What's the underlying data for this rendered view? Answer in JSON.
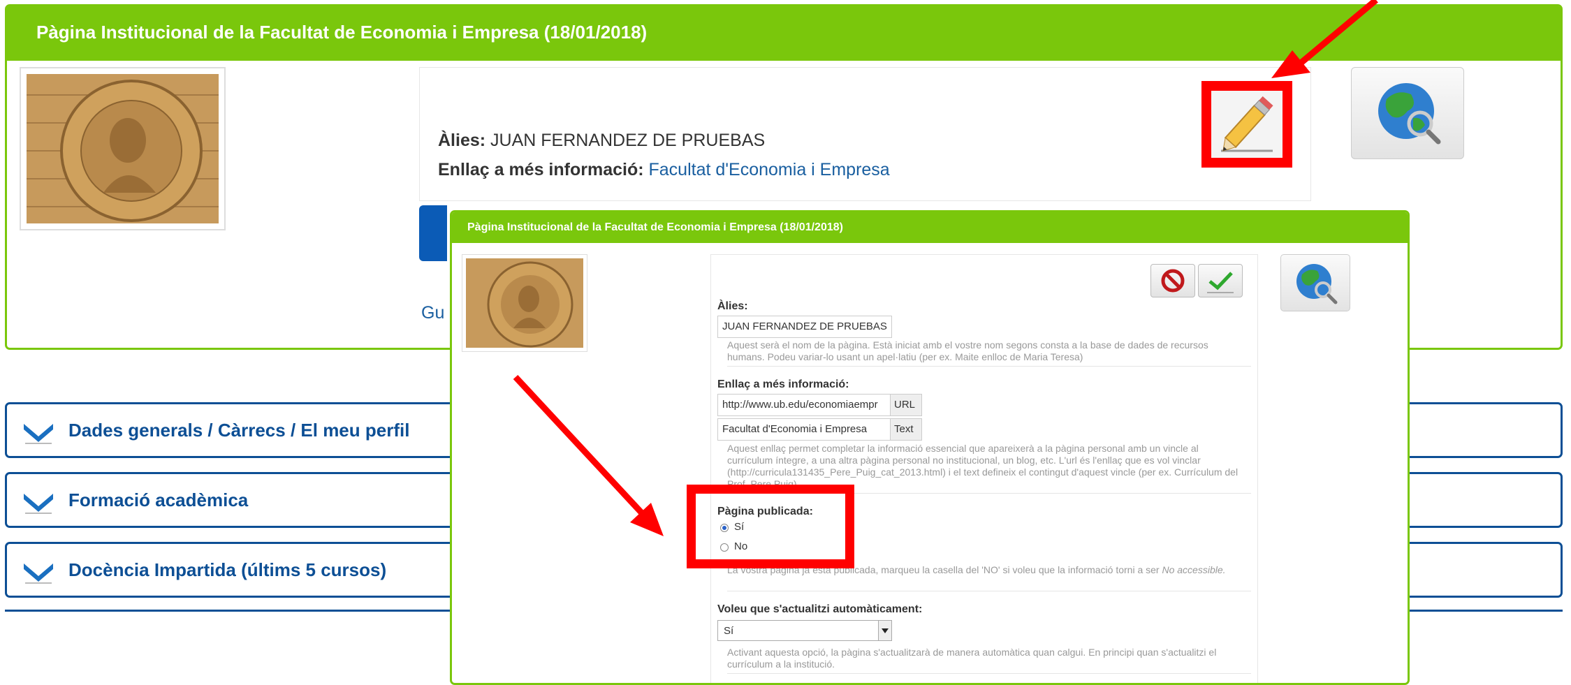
{
  "panel": {
    "title": "Pàgina Institucional de la Facultat de Economia i Empresa (18/01/2018)",
    "alias_label": "Àlies:",
    "alias_value": "JUAN FERNANDEZ DE PRUEBAS",
    "link_label": "Enllaç a més informació:",
    "link_value": "Facultat d'Economia i Empresa",
    "partial_link": "Gu"
  },
  "accordion": [
    {
      "label": "Dades generals / Càrrecs / El meu perfil"
    },
    {
      "label": "Formació acadèmica"
    },
    {
      "label": "Docència Impartida (últims 5 cursos)"
    }
  ],
  "dialog": {
    "title": "Pàgina Institucional de la Facultat de Economia i Empresa (18/01/2018)",
    "alias_label": "Àlies:",
    "alias_input": "JUAN FERNANDEZ DE PRUEBAS",
    "alias_help": "Aquest serà el nom de la pàgina. Està iniciat amb el vostre nom segons consta a la base de dades de recursos humans. Podeu variar-lo usant un apel·latiu (per ex. Maite enlloc de Maria Teresa)",
    "link_label": "Enllaç a més informació:",
    "url_input": "http://www.ub.edu/economiaempr",
    "url_addon": "URL",
    "text_input": "Facultat d'Economia i Empresa",
    "text_addon": "Text",
    "link_help": "Aquest enllaç permet completar la informació essencial que apareixerà a la pàgina personal amb un vincle al currículum íntegre, a una altra pàgina personal no institucional, un blog, etc. L'url és l'enllaç que es vol vinclar (http://curricula131435_Pere_Puig_cat_2013.html) i el text defineix el contingut d'aquest vincle (per ex. Currículum del Prof. Pere Puig)",
    "published_label": "Pàgina publicada:",
    "published_yes": "Sí",
    "published_no": "No",
    "published_selected": "Sí",
    "published_help": "La vostra pàgina ja està publicada, marqueu la casella del 'NO' si voleu que la informació torni a ser",
    "published_help_em": "No accessible.",
    "auto_label": "Voleu que s'actualitzi automàticament:",
    "auto_value": "Sí",
    "auto_help": "Activant aquesta opció, la pàgina s'actualitzarà de manera automàtica quan calgui. En principi quan s'actualitzi el currículum a la institució."
  },
  "colors": {
    "header_green": "#7ac70c",
    "accordion_blue": "#0d4f95",
    "link_blue": "#1a5fa0",
    "highlight_red": "#ff0000"
  },
  "icons": [
    "pencil-icon",
    "globe-search-icon",
    "chevron-down-icon",
    "cancel-icon",
    "check-icon",
    "portrait-medallion"
  ]
}
